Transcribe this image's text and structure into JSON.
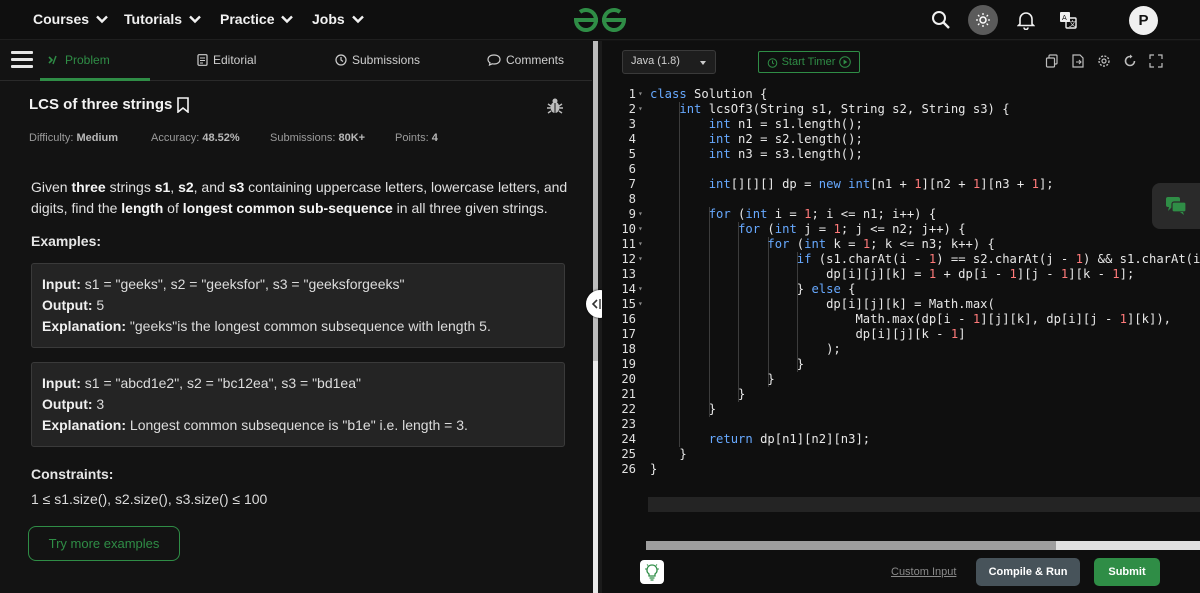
{
  "topnav": {
    "items": [
      {
        "label": "Courses"
      },
      {
        "label": "Tutorials"
      },
      {
        "label": "Practice"
      },
      {
        "label": "Jobs"
      }
    ],
    "avatar_letter": "P"
  },
  "tabs": [
    {
      "label": "Problem",
      "active": true
    },
    {
      "label": "Editorial",
      "active": false
    },
    {
      "label": "Submissions",
      "active": false
    },
    {
      "label": "Comments",
      "active": false
    }
  ],
  "problem": {
    "title": "LCS of three strings",
    "difficulty_label": "Difficulty:",
    "difficulty": "Medium",
    "accuracy_label": "Accuracy:",
    "accuracy": "48.52%",
    "submissions_label": "Submissions:",
    "submissions": "80K+",
    "points_label": "Points:",
    "points": "4",
    "desc_parts": [
      "Given ",
      "three",
      " strings ",
      "s1",
      ", ",
      "s2",
      ", and ",
      "s3",
      " containing uppercase letters, lowercase letters, and digits, find the ",
      "length",
      " of ",
      "longest common sub-sequence",
      " in all three given strings."
    ],
    "examples_label": "Examples:",
    "example1": {
      "input_label": "Input:",
      "input": " s1  =  \"geeks\",  s2  =  \"geeksfor\",  s3  =  \"geeksforgeeks\"",
      "output_label": "Output:",
      "output": " 5",
      "explanation_label": "Explanation:",
      "explanation": " \"geeks\"is  the  longest  common  subsequence  with  length  5."
    },
    "example2": {
      "input_label": "Input:",
      "input": "  s1  =  \"abcd1e2\",  s2  =  \"bc12ea\",  s3  =  \"bd1ea\"",
      "output_label": "Output:",
      "output": "  3",
      "explanation_label": "Explanation:",
      "explanation": "   Longest  common  subsequence  is  \"b1e\"  i.e.  length  =  3."
    },
    "constraints_label": "Constraints:",
    "constraints": "1  ≤  s1.size(), s2.size(), s3.size()  ≤  100",
    "try_more": "Try more examples"
  },
  "editor": {
    "language": "Java (1.8)",
    "timer_label": "Start Timer",
    "lines": [
      "class Solution {",
      "    int lcsOf3(String s1, String s2, String s3) {",
      "        int n1 = s1.length();",
      "        int n2 = s2.length();",
      "        int n3 = s3.length();",
      "",
      "        int[][][] dp = new int[n1 + 1][n2 + 1][n3 + 1];",
      "",
      "        for (int i = 1; i <= n1; i++) {",
      "            for (int j = 1; j <= n2; j++) {",
      "                for (int k = 1; k <= n3; k++) {",
      "                    if (s1.charAt(i - 1) == s2.charAt(j - 1) && s1.charAt(i",
      "                        dp[i][j][k] = 1 + dp[i - 1][j - 1][k - 1];",
      "                    } else {",
      "                        dp[i][j][k] = Math.max(",
      "                            Math.max(dp[i - 1][j][k], dp[i][j - 1][k]),",
      "                            dp[i][j][k - 1]",
      "                        );",
      "                    }",
      "                }",
      "            }",
      "        }",
      "",
      "        return dp[n1][n2][n3];",
      "    }",
      "}"
    ],
    "custom_input": "Custom Input",
    "compile_label": "Compile & Run",
    "submit_label": "Submit"
  },
  "colors": {
    "accent": "#2f8d46",
    "keyword": "#67a9ff",
    "number": "#ff7a7a"
  }
}
